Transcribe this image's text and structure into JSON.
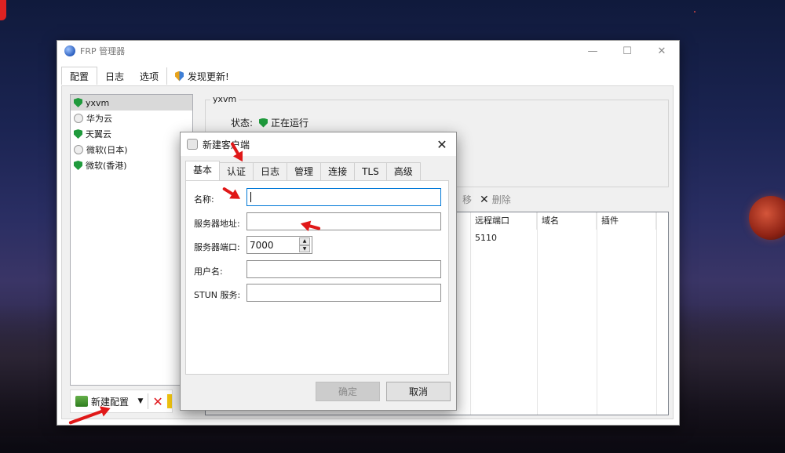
{
  "app": {
    "title": "FRP 管理器"
  },
  "window_controls": {
    "minimize": "—",
    "maximize": "☐",
    "close": "✕"
  },
  "menu_tabs": [
    "配置",
    "日志",
    "选项"
  ],
  "update_link": "发现更新!",
  "configs": [
    {
      "name": "yxvm",
      "status": "running"
    },
    {
      "name": "华为云",
      "status": "stopped"
    },
    {
      "name": "天翼云",
      "status": "running"
    },
    {
      "name": "微软(日本)",
      "status": "stopped"
    },
    {
      "name": "微软(香港)",
      "status": "running"
    }
  ],
  "bottom_toolbar": {
    "new_config": "新建配置"
  },
  "details": {
    "group_title": "yxvm",
    "status_label": "状态:",
    "status_value": "正在运行"
  },
  "proxy_toolbar": {
    "partial_prev": "移",
    "delete": "删除"
  },
  "proxy_table": {
    "columns": [
      "远程端口",
      "域名",
      "插件"
    ],
    "rows": [
      {
        "remote_port": "5110",
        "domain": "",
        "plugin": ""
      }
    ]
  },
  "dialog": {
    "title": "新建客户端",
    "tabs": [
      "基本",
      "认证",
      "日志",
      "管理",
      "连接",
      "TLS",
      "高级"
    ],
    "fields": {
      "name_label": "名称:",
      "name_value": "",
      "server_addr_label": "服务器地址:",
      "server_addr_value": "",
      "server_port_label": "服务器端口:",
      "server_port_value": "7000",
      "user_label": "用户名:",
      "user_value": "",
      "stun_label": "STUN 服务:",
      "stun_value": ""
    },
    "buttons": {
      "ok": "确定",
      "cancel": "取消"
    }
  },
  "colors": {
    "accent_focus": "#0078d7",
    "status_green": "#1f9a3c",
    "delete_red": "#e0181d",
    "annotation_red": "#e01818"
  }
}
